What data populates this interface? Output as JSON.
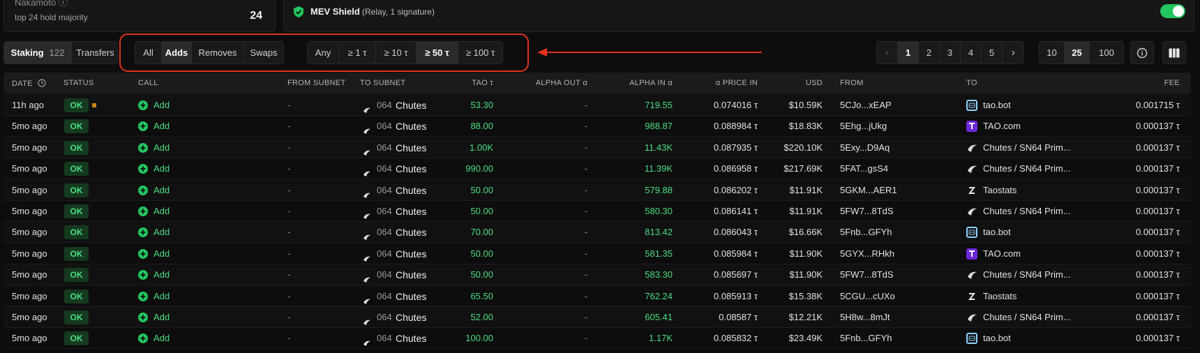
{
  "summary": {
    "title": "Nakamoto ⓘ",
    "subtitle": "top 24 hold majority",
    "value": "24"
  },
  "mev": {
    "title": "MEV Shield",
    "subtitle": "(Relay, 1 signature)",
    "enabled": true
  },
  "tabs": {
    "staking_label": "Staking",
    "staking_count": "122",
    "transfers_label": "Transfers"
  },
  "type_filter": [
    "All",
    "Adds",
    "Removes",
    "Swaps"
  ],
  "type_filter_active": "Adds",
  "amount_filter": [
    "Any",
    "≥ 1 τ",
    "≥ 10 τ",
    "≥ 50 τ",
    "≥ 100 τ"
  ],
  "amount_filter_active": "≥ 50 τ",
  "pagination": {
    "pages": [
      "1",
      "2",
      "3",
      "4",
      "5"
    ],
    "current": "1",
    "prev_icon": "chevron-left-icon",
    "next_icon": "chevron-right-icon"
  },
  "page_size": {
    "options": [
      "10",
      "25",
      "100"
    ],
    "current": "25"
  },
  "headers": {
    "date": "DATE",
    "status": "STATUS",
    "call": "CALL",
    "from_subnet": "FROM SUBNET",
    "to_subnet": "TO SUBNET",
    "tao": "TAO τ",
    "alpha_out": "ALPHA OUT α",
    "alpha_in": "ALPHA IN α",
    "price": "α PRICE IN",
    "usd": "USD",
    "from": "FROM",
    "to": "TO",
    "fee": "FEE"
  },
  "colors": {
    "accent_green": "#22c55e",
    "highlight_red": "#e0321f",
    "taocom_purple": "#6d28d9"
  },
  "rows": [
    {
      "date": "11h ago",
      "status": "OK",
      "pending": true,
      "call": "Add",
      "from_subnet": "-",
      "to_num": "064",
      "to_name": "Chutes",
      "tao": "53.30",
      "alpha_out": "-",
      "alpha_in": "719.55",
      "price": "0.074016 τ",
      "usd": "$10.59K",
      "from": "5CJo...xEAP",
      "dest_icon": "taobot",
      "to": "tao.bot",
      "fee": "0.001715 τ"
    },
    {
      "date": "5mo ago",
      "status": "OK",
      "pending": false,
      "call": "Add",
      "from_subnet": "-",
      "to_num": "064",
      "to_name": "Chutes",
      "tao": "88.00",
      "alpha_out": "-",
      "alpha_in": "988.87",
      "price": "0.088984 τ",
      "usd": "$18.83K",
      "from": "5Ehg...jUkg",
      "dest_icon": "taocom",
      "to": "TAO.com",
      "fee": "0.000137 τ"
    },
    {
      "date": "5mo ago",
      "status": "OK",
      "pending": false,
      "call": "Add",
      "from_subnet": "-",
      "to_num": "064",
      "to_name": "Chutes",
      "tao": "1.00K",
      "alpha_out": "-",
      "alpha_in": "11.43K",
      "price": "0.087935 τ",
      "usd": "$220.10K",
      "from": "5Exy...D9Aq",
      "dest_icon": "chutes",
      "to": "Chutes / SN64 Prim...",
      "fee": "0.000137 τ"
    },
    {
      "date": "5mo ago",
      "status": "OK",
      "pending": false,
      "call": "Add",
      "from_subnet": "-",
      "to_num": "064",
      "to_name": "Chutes",
      "tao": "990.00",
      "alpha_out": "-",
      "alpha_in": "11.39K",
      "price": "0.086958 τ",
      "usd": "$217.69K",
      "from": "5FAT...gsS4",
      "dest_icon": "chutes",
      "to": "Chutes / SN64 Prim...",
      "fee": "0.000137 τ"
    },
    {
      "date": "5mo ago",
      "status": "OK",
      "pending": false,
      "call": "Add",
      "from_subnet": "-",
      "to_num": "064",
      "to_name": "Chutes",
      "tao": "50.00",
      "alpha_out": "-",
      "alpha_in": "579.88",
      "price": "0.086202 τ",
      "usd": "$11.91K",
      "from": "5GKM...AER1",
      "dest_icon": "taostats",
      "to": "Taostats",
      "fee": "0.000137 τ"
    },
    {
      "date": "5mo ago",
      "status": "OK",
      "pending": false,
      "call": "Add",
      "from_subnet": "-",
      "to_num": "064",
      "to_name": "Chutes",
      "tao": "50.00",
      "alpha_out": "-",
      "alpha_in": "580.30",
      "price": "0.086141 τ",
      "usd": "$11.91K",
      "from": "5FW7...8TdS",
      "dest_icon": "chutes",
      "to": "Chutes / SN64 Prim...",
      "fee": "0.000137 τ"
    },
    {
      "date": "5mo ago",
      "status": "OK",
      "pending": false,
      "call": "Add",
      "from_subnet": "-",
      "to_num": "064",
      "to_name": "Chutes",
      "tao": "70.00",
      "alpha_out": "-",
      "alpha_in": "813.42",
      "price": "0.086043 τ",
      "usd": "$16.66K",
      "from": "5Fnb...GFYh",
      "dest_icon": "taobot",
      "to": "tao.bot",
      "fee": "0.000137 τ"
    },
    {
      "date": "5mo ago",
      "status": "OK",
      "pending": false,
      "call": "Add",
      "from_subnet": "-",
      "to_num": "064",
      "to_name": "Chutes",
      "tao": "50.00",
      "alpha_out": "-",
      "alpha_in": "581.35",
      "price": "0.085984 τ",
      "usd": "$11.90K",
      "from": "5GYX...RHkh",
      "dest_icon": "taocom",
      "to": "TAO.com",
      "fee": "0.000137 τ"
    },
    {
      "date": "5mo ago",
      "status": "OK",
      "pending": false,
      "call": "Add",
      "from_subnet": "-",
      "to_num": "064",
      "to_name": "Chutes",
      "tao": "50.00",
      "alpha_out": "-",
      "alpha_in": "583.30",
      "price": "0.085697 τ",
      "usd": "$11.90K",
      "from": "5FW7...8TdS",
      "dest_icon": "chutes",
      "to": "Chutes / SN64 Prim...",
      "fee": "0.000137 τ"
    },
    {
      "date": "5mo ago",
      "status": "OK",
      "pending": false,
      "call": "Add",
      "from_subnet": "-",
      "to_num": "064",
      "to_name": "Chutes",
      "tao": "65.50",
      "alpha_out": "-",
      "alpha_in": "762.24",
      "price": "0.085913 τ",
      "usd": "$15.38K",
      "from": "5CGU...cUXo",
      "dest_icon": "taostats",
      "to": "Taostats",
      "fee": "0.000137 τ"
    },
    {
      "date": "5mo ago",
      "status": "OK",
      "pending": false,
      "call": "Add",
      "from_subnet": "-",
      "to_num": "064",
      "to_name": "Chutes",
      "tao": "52.00",
      "alpha_out": "-",
      "alpha_in": "605.41",
      "price": "0.08587 τ",
      "usd": "$12.21K",
      "from": "5H8w...8mJt",
      "dest_icon": "chutes",
      "to": "Chutes / SN64 Prim...",
      "fee": "0.000137 τ"
    },
    {
      "date": "5mo ago",
      "status": "OK",
      "pending": false,
      "call": "Add",
      "from_subnet": "-",
      "to_num": "064",
      "to_name": "Chutes",
      "tao": "100.00",
      "alpha_out": "-",
      "alpha_in": "1.17K",
      "price": "0.085832 τ",
      "usd": "$23.49K",
      "from": "5Fnb...GFYh",
      "dest_icon": "taobot",
      "to": "tao.bot",
      "fee": "0.000137 τ"
    }
  ]
}
